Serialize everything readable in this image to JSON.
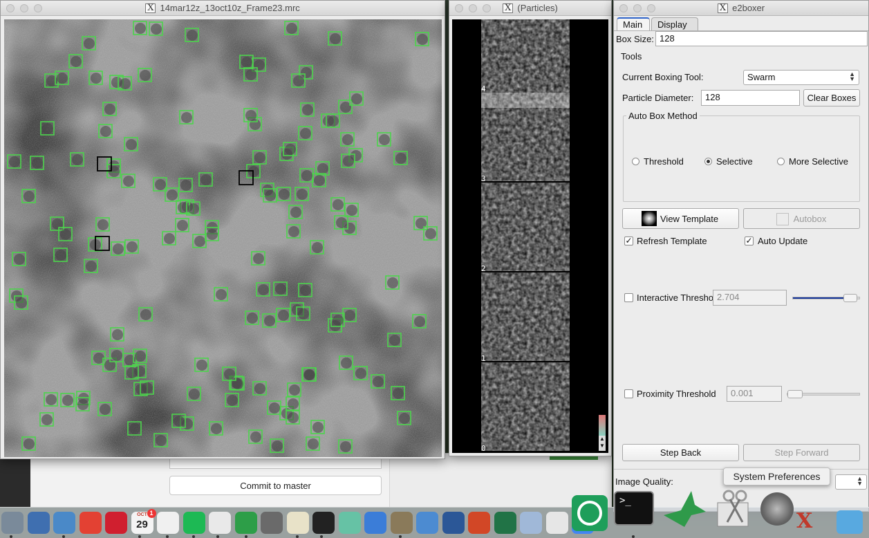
{
  "micrograph_window": {
    "title": "14mar12z_13oct10z_Frame23.mrc"
  },
  "particles_window": {
    "title": "(Particles)",
    "particle_labels": [
      "4",
      "3",
      "2",
      "1",
      "0"
    ]
  },
  "e2boxer": {
    "title": "e2boxer",
    "tabs": [
      "Main",
      "Display"
    ],
    "box_size_label": "Box Size:",
    "box_size_value": "128",
    "tools_label": "Tools",
    "current_tool_label": "Current Boxing Tool:",
    "current_tool_value": "Swarm",
    "particle_diameter_label": "Particle Diameter:",
    "particle_diameter_value": "128",
    "clear_boxes": "Clear Boxes",
    "auto_box_method_label": "Auto Box Method",
    "methods": [
      "Threshold",
      "Selective",
      "More Selective"
    ],
    "selected_method": "Selective",
    "view_template": "View Template",
    "autobox": "Autobox",
    "refresh_template": "Refresh Template",
    "refresh_template_checked": true,
    "auto_update": "Auto Update",
    "auto_update_checked": true,
    "interactive_threshold_label": "Interactive Threshold",
    "interactive_threshold_value": "2.704",
    "interactive_threshold_level": 0.86,
    "proximity_threshold_label": "Proximity Threshold",
    "proximity_threshold_value": "0.001",
    "proximity_threshold_level": 0.0,
    "step_back": "Step Back",
    "step_forward": "Step Forward",
    "image_quality_label": "Image Quality:"
  },
  "background_app": {
    "commit_button": "Commit to master"
  },
  "tooltip": {
    "text": "System Preferences"
  },
  "dock": {
    "calendar_month": "OCT",
    "calendar_day": "29",
    "calendar_badge": "1",
    "apps": [
      "finder-icon",
      "launchpad-icon",
      "preview-icon",
      "chrome-icon",
      "quicken-icon",
      "calendar-icon",
      "scrivener-icon",
      "spotify-icon",
      "itunes-icon",
      "evernote-icon",
      "quicktime-icon",
      "textedit-icon",
      "github-icon",
      "atom-icon",
      "numbers-icon",
      "gimp-icon",
      "keynote-icon",
      "word-icon",
      "powerpoint-icon",
      "excel-icon",
      "xcode-icon",
      "preview2-icon",
      "picasa-icon",
      "snowflake-icon",
      "terminal-icon",
      "hummingbird-icon",
      "scissors-icon",
      "system-preferences-icon",
      "xquartz-icon",
      "downloads-icon"
    ]
  },
  "colors": {
    "box_green": "#4cd44c",
    "box_selected": "#000000",
    "slider_blue": "#14349a",
    "tab_accent": "#2f63c9"
  }
}
